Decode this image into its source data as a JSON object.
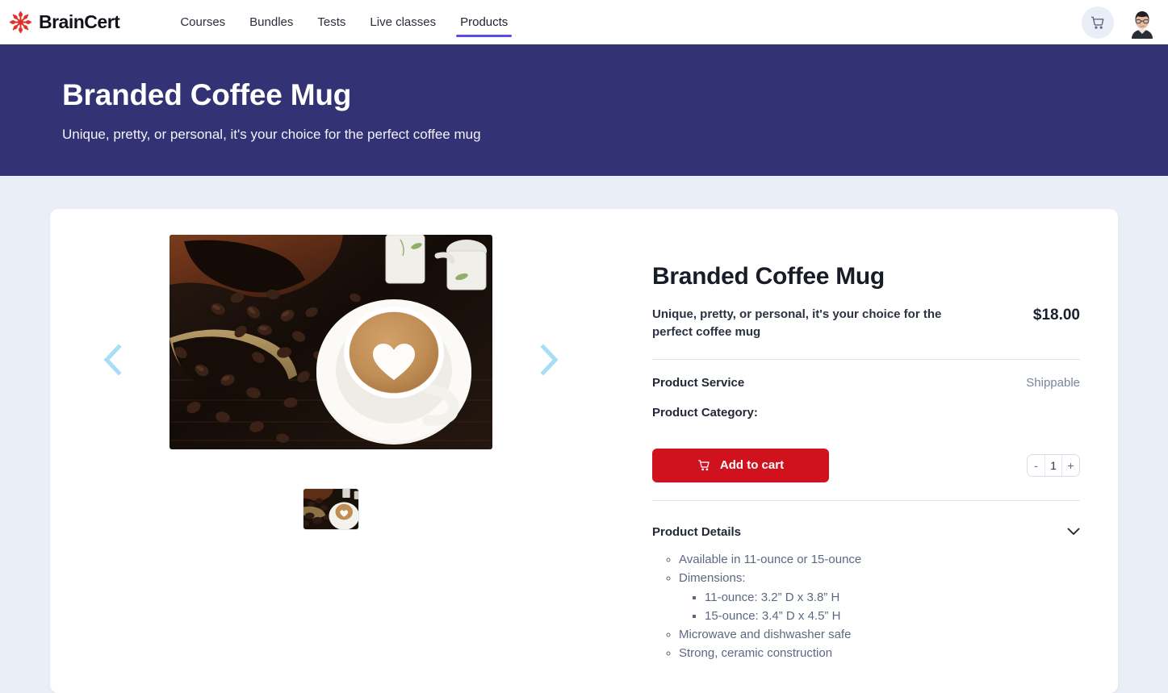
{
  "nav": {
    "logo_text": "BrainCert",
    "logo_icon": "braincert-snowflake-logo",
    "items": [
      {
        "label": "Courses",
        "active": false
      },
      {
        "label": "Bundles",
        "active": false
      },
      {
        "label": "Tests",
        "active": false
      },
      {
        "label": "Live classes",
        "active": false
      },
      {
        "label": "Products",
        "active": true
      }
    ],
    "cart_icon": "shopping-cart-icon",
    "avatar_icon": "user-avatar"
  },
  "hero": {
    "title": "Branded Coffee Mug",
    "subtitle": "Unique, pretty, or personal, it's your choice for the perfect coffee mug"
  },
  "gallery": {
    "prev_icon": "chevron-left-icon",
    "next_icon": "chevron-right-icon",
    "main_image_alt": "latte-with-heart-art-and-coffee-beans",
    "thumb_alt": "latte-thumbnail"
  },
  "product": {
    "title": "Branded Coffee Mug",
    "description": "Unique, pretty, or personal, it's your choice for the perfect coffee mug",
    "price": "$18.00",
    "service_label": "Product Service",
    "service_value": "Shippable",
    "category_label": "Product Category:",
    "category_value": "",
    "add_to_cart_label": "Add to cart",
    "add_to_cart_icon": "cart-icon",
    "quantity": "1",
    "decrement_label": "-",
    "increment_label": "+",
    "details_title": "Product Details",
    "details_chevron_icon": "chevron-down-icon",
    "details": [
      {
        "text": "Available in 11-ounce or 15-ounce",
        "children": []
      },
      {
        "text": "Dimensions:",
        "children": [
          "11-ounce: 3.2” D x 3.8” H",
          "15-ounce: 3.4” D x 4.5” H"
        ]
      },
      {
        "text": "Microwave and dishwasher safe",
        "children": []
      },
      {
        "text": "Strong, ceramic construction",
        "children": []
      }
    ]
  },
  "colors": {
    "hero_bg": "#333275",
    "page_bg": "#eaeef7",
    "accent_purple": "#5b4be8",
    "cart_red": "#d0121f",
    "logo_red": "#e03127",
    "arrow_blue": "#a9ddf6"
  }
}
